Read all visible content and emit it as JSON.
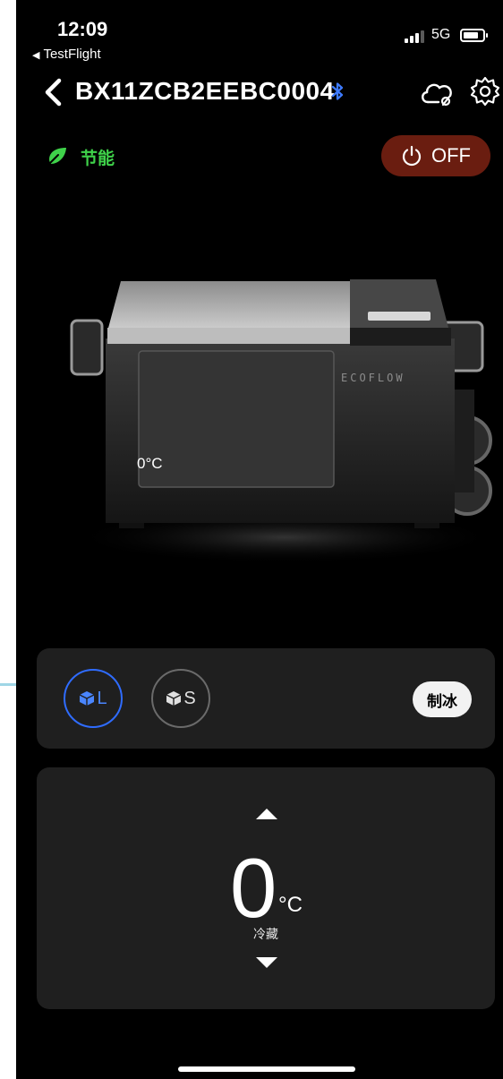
{
  "status_bar": {
    "time": "12:09",
    "back_app": "TestFlight",
    "network": "5G"
  },
  "header": {
    "device_id": "BX11ZCB2EEBC0004"
  },
  "eco_mode": {
    "label": "节能",
    "color": "#3fd24a"
  },
  "power_button": {
    "label": "OFF",
    "color": "#6a1d10"
  },
  "product_overlay": {
    "temperature": "0°C"
  },
  "compartments": [
    {
      "label": "L",
      "selected": true,
      "accent": "#2f6cff"
    },
    {
      "label": "S",
      "selected": false
    }
  ],
  "ice_button": {
    "label": "制冰"
  },
  "temperature": {
    "value": "0",
    "unit": "°C",
    "mode": "冷藏"
  }
}
